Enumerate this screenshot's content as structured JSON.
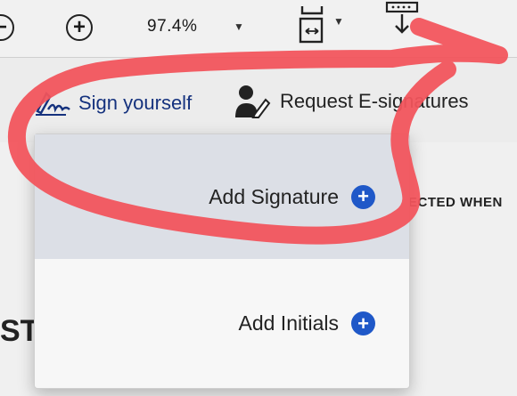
{
  "toolbar": {
    "zoom_out_icon": "minus-circle-icon",
    "zoom_in_icon": "plus-circle-icon",
    "zoom_value": "97.4%",
    "fit_page_icon": "fit-page-icon",
    "download_icon": "download-arrow-icon"
  },
  "sign_bar": {
    "sign_yourself": "Sign yourself",
    "request_esignatures": "Request E-signatures"
  },
  "menu": {
    "items": [
      {
        "label": "Add Signature",
        "icon": "plus-circle-icon"
      },
      {
        "label": "Add Initials",
        "icon": "plus-circle-icon"
      }
    ]
  },
  "background_text": {
    "right_fragment": "ECTED WHEN",
    "left_fragment": "ST"
  },
  "colors": {
    "accent_blue": "#1f58c8",
    "sign_text_blue": "#15327e",
    "annotation_red": "#f2545b",
    "menu_highlight": "#dcdfe6"
  }
}
